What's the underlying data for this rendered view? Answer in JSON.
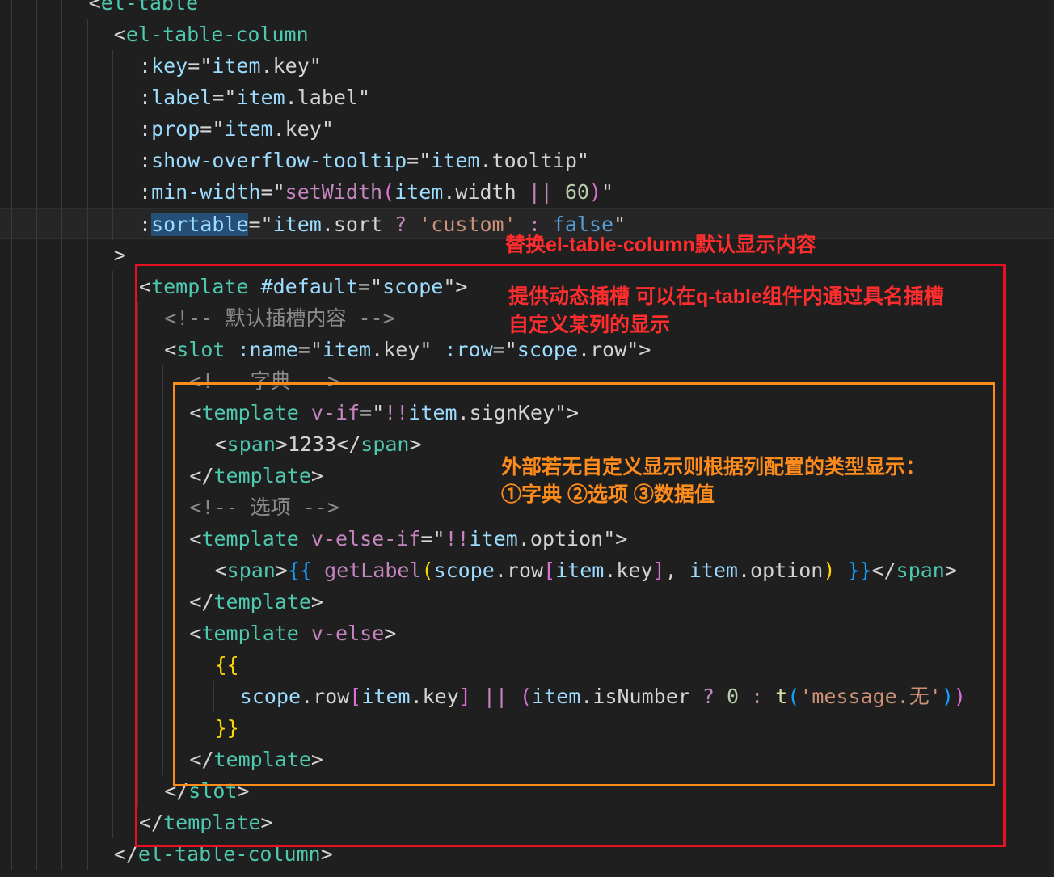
{
  "editor": {
    "lines": [
      {
        "indent": 3,
        "tokens": [
          {
            "c": "t-punc",
            "v": "<"
          },
          {
            "c": "t-tag",
            "v": "el-table"
          }
        ]
      },
      {
        "indent": 4,
        "tokens": [
          {
            "c": "t-punc",
            "v": "<"
          },
          {
            "c": "t-tag",
            "v": "el-table-column"
          }
        ]
      },
      {
        "indent": 5,
        "tokens": [
          {
            "c": "t-punc",
            "v": ":"
          },
          {
            "c": "t-attr",
            "v": "key"
          },
          {
            "c": "t-punc",
            "v": "=\""
          },
          {
            "c": "t-ident",
            "v": "item"
          },
          {
            "c": "t-punc",
            "v": "."
          },
          {
            "c": "t-prop",
            "v": "key"
          },
          {
            "c": "t-punc",
            "v": "\""
          }
        ]
      },
      {
        "indent": 5,
        "tokens": [
          {
            "c": "t-punc",
            "v": ":"
          },
          {
            "c": "t-attr",
            "v": "label"
          },
          {
            "c": "t-punc",
            "v": "=\""
          },
          {
            "c": "t-ident",
            "v": "item"
          },
          {
            "c": "t-punc",
            "v": "."
          },
          {
            "c": "t-prop",
            "v": "label"
          },
          {
            "c": "t-punc",
            "v": "\""
          }
        ]
      },
      {
        "indent": 5,
        "tokens": [
          {
            "c": "t-punc",
            "v": ":"
          },
          {
            "c": "t-attr",
            "v": "prop"
          },
          {
            "c": "t-punc",
            "v": "=\""
          },
          {
            "c": "t-ident",
            "v": "item"
          },
          {
            "c": "t-punc",
            "v": "."
          },
          {
            "c": "t-prop",
            "v": "key"
          },
          {
            "c": "t-punc",
            "v": "\""
          }
        ]
      },
      {
        "indent": 5,
        "tokens": [
          {
            "c": "t-punc",
            "v": ":"
          },
          {
            "c": "t-attr",
            "v": "show-overflow-tooltip"
          },
          {
            "c": "t-punc",
            "v": "=\""
          },
          {
            "c": "t-ident",
            "v": "item"
          },
          {
            "c": "t-punc",
            "v": "."
          },
          {
            "c": "t-prop",
            "v": "tooltip"
          },
          {
            "c": "t-punc",
            "v": "\""
          }
        ]
      },
      {
        "indent": 5,
        "tokens": [
          {
            "c": "t-punc",
            "v": ":"
          },
          {
            "c": "t-attr",
            "v": "min-width"
          },
          {
            "c": "t-punc",
            "v": "=\""
          },
          {
            "c": "t-fn2",
            "v": "setWidth"
          },
          {
            "c": "t-bracket2",
            "v": "("
          },
          {
            "c": "t-ident",
            "v": "item"
          },
          {
            "c": "t-punc",
            "v": "."
          },
          {
            "c": "t-prop",
            "v": "width "
          },
          {
            "c": "t-op",
            "v": "||"
          },
          {
            "c": "t-num",
            "v": " 60"
          },
          {
            "c": "t-bracket2",
            "v": ")"
          },
          {
            "c": "t-punc",
            "v": "\""
          }
        ]
      },
      {
        "indent": 5,
        "current": true,
        "tokens": [
          {
            "c": "t-punc",
            "v": ":"
          },
          {
            "c": "t-attr t-sel",
            "v": "sortable"
          },
          {
            "c": "t-punc",
            "v": "=\""
          },
          {
            "c": "t-ident",
            "v": "item"
          },
          {
            "c": "t-punc",
            "v": "."
          },
          {
            "c": "t-prop",
            "v": "sort "
          },
          {
            "c": "t-op",
            "v": "?"
          },
          {
            "c": "t-str",
            "v": " 'custom' "
          },
          {
            "c": "t-op",
            "v": ":"
          },
          {
            "c": "t-const",
            "v": " false"
          },
          {
            "c": "t-punc",
            "v": "\""
          }
        ]
      },
      {
        "indent": 4,
        "tokens": [
          {
            "c": "t-punc",
            "v": ">"
          }
        ]
      },
      {
        "indent": 5,
        "tokens": [
          {
            "c": "t-punc",
            "v": "<"
          },
          {
            "c": "t-tag",
            "v": "template"
          },
          {
            "c": "t-attr",
            "v": " #default"
          },
          {
            "c": "t-punc",
            "v": "=\""
          },
          {
            "c": "t-ident",
            "v": "scope"
          },
          {
            "c": "t-punc",
            "v": "\">"
          }
        ]
      },
      {
        "indent": 6,
        "tokens": [
          {
            "c": "t-comment",
            "v": "<!-- 默认插槽内容 -->"
          }
        ]
      },
      {
        "indent": 6,
        "tokens": [
          {
            "c": "t-punc",
            "v": "<"
          },
          {
            "c": "t-tag",
            "v": "slot"
          },
          {
            "c": "t-attr",
            "v": " :name"
          },
          {
            "c": "t-punc",
            "v": "=\""
          },
          {
            "c": "t-ident",
            "v": "item"
          },
          {
            "c": "t-punc",
            "v": "."
          },
          {
            "c": "t-prop",
            "v": "key"
          },
          {
            "c": "t-punc",
            "v": "\""
          },
          {
            "c": "t-attr",
            "v": " :row"
          },
          {
            "c": "t-punc",
            "v": "=\""
          },
          {
            "c": "t-ident",
            "v": "scope"
          },
          {
            "c": "t-punc",
            "v": "."
          },
          {
            "c": "t-prop",
            "v": "row"
          },
          {
            "c": "t-punc",
            "v": "\">"
          }
        ]
      },
      {
        "indent": 7,
        "tokens": [
          {
            "c": "t-comment",
            "v": "<!-- 字典 -->"
          }
        ]
      },
      {
        "indent": 7,
        "tokens": [
          {
            "c": "t-punc",
            "v": "<"
          },
          {
            "c": "t-tag",
            "v": "template"
          },
          {
            "c": "t-dir",
            "v": " v-if"
          },
          {
            "c": "t-punc",
            "v": "=\""
          },
          {
            "c": "t-op",
            "v": "!!"
          },
          {
            "c": "t-ident",
            "v": "item"
          },
          {
            "c": "t-punc",
            "v": "."
          },
          {
            "c": "t-prop",
            "v": "signKey"
          },
          {
            "c": "t-punc",
            "v": "\">"
          }
        ]
      },
      {
        "indent": 8,
        "tokens": [
          {
            "c": "t-punc",
            "v": "<"
          },
          {
            "c": "t-tag",
            "v": "span"
          },
          {
            "c": "t-punc",
            "v": ">"
          },
          {
            "c": "t-text",
            "v": "1233"
          },
          {
            "c": "t-punc",
            "v": "</"
          },
          {
            "c": "t-tag",
            "v": "span"
          },
          {
            "c": "t-punc",
            "v": ">"
          }
        ]
      },
      {
        "indent": 7,
        "tokens": [
          {
            "c": "t-punc",
            "v": "</"
          },
          {
            "c": "t-tag",
            "v": "template"
          },
          {
            "c": "t-punc",
            "v": ">"
          }
        ]
      },
      {
        "indent": 7,
        "tokens": [
          {
            "c": "t-comment",
            "v": "<!-- 选项 -->"
          }
        ]
      },
      {
        "indent": 7,
        "tokens": [
          {
            "c": "t-punc",
            "v": "<"
          },
          {
            "c": "t-tag",
            "v": "template"
          },
          {
            "c": "t-dir",
            "v": " v-else-if"
          },
          {
            "c": "t-punc",
            "v": "=\""
          },
          {
            "c": "t-op",
            "v": "!!"
          },
          {
            "c": "t-ident",
            "v": "item"
          },
          {
            "c": "t-punc",
            "v": "."
          },
          {
            "c": "t-prop",
            "v": "option"
          },
          {
            "c": "t-punc",
            "v": "\">"
          }
        ]
      },
      {
        "indent": 8,
        "tokens": [
          {
            "c": "t-punc",
            "v": "<"
          },
          {
            "c": "t-tag",
            "v": "span"
          },
          {
            "c": "t-punc",
            "v": ">"
          },
          {
            "c": "t-bracket3",
            "v": "{{"
          },
          {
            "c": "t-fn2",
            "v": " getLabel"
          },
          {
            "c": "t-bracket",
            "v": "("
          },
          {
            "c": "t-ident",
            "v": "scope"
          },
          {
            "c": "t-punc",
            "v": "."
          },
          {
            "c": "t-prop",
            "v": "row"
          },
          {
            "c": "t-bracket2",
            "v": "["
          },
          {
            "c": "t-ident",
            "v": "item"
          },
          {
            "c": "t-punc",
            "v": "."
          },
          {
            "c": "t-prop",
            "v": "key"
          },
          {
            "c": "t-bracket2",
            "v": "]"
          },
          {
            "c": "t-punc",
            "v": ", "
          },
          {
            "c": "t-ident",
            "v": "item"
          },
          {
            "c": "t-punc",
            "v": "."
          },
          {
            "c": "t-prop",
            "v": "option"
          },
          {
            "c": "t-bracket",
            "v": ")"
          },
          {
            "c": "t-bracket3",
            "v": " }}"
          },
          {
            "c": "t-punc",
            "v": "</"
          },
          {
            "c": "t-tag",
            "v": "span"
          },
          {
            "c": "t-punc",
            "v": ">"
          }
        ]
      },
      {
        "indent": 7,
        "tokens": [
          {
            "c": "t-punc",
            "v": "</"
          },
          {
            "c": "t-tag",
            "v": "template"
          },
          {
            "c": "t-punc",
            "v": ">"
          }
        ]
      },
      {
        "indent": 7,
        "tokens": [
          {
            "c": "t-punc",
            "v": "<"
          },
          {
            "c": "t-tag",
            "v": "template"
          },
          {
            "c": "t-dir",
            "v": " v-else"
          },
          {
            "c": "t-punc",
            "v": ">"
          }
        ]
      },
      {
        "indent": 8,
        "tokens": [
          {
            "c": "t-bracket",
            "v": "{{"
          }
        ]
      },
      {
        "indent": 9,
        "tokens": [
          {
            "c": "t-ident",
            "v": "scope"
          },
          {
            "c": "t-punc",
            "v": "."
          },
          {
            "c": "t-prop",
            "v": "row"
          },
          {
            "c": "t-bracket2",
            "v": "["
          },
          {
            "c": "t-ident",
            "v": "item"
          },
          {
            "c": "t-punc",
            "v": "."
          },
          {
            "c": "t-prop",
            "v": "key"
          },
          {
            "c": "t-bracket2",
            "v": "]"
          },
          {
            "c": "t-op",
            "v": " ||"
          },
          {
            "c": "t-bracket2",
            "v": " ("
          },
          {
            "c": "t-ident",
            "v": "item"
          },
          {
            "c": "t-punc",
            "v": "."
          },
          {
            "c": "t-prop",
            "v": "isNumber "
          },
          {
            "c": "t-op",
            "v": "?"
          },
          {
            "c": "t-num",
            "v": " 0 "
          },
          {
            "c": "t-op",
            "v": ":"
          },
          {
            "c": "t-fn",
            "v": " t"
          },
          {
            "c": "t-bracket3",
            "v": "("
          },
          {
            "c": "t-str",
            "v": "'message.无'"
          },
          {
            "c": "t-bracket3",
            "v": ")"
          },
          {
            "c": "t-bracket2",
            "v": ")"
          }
        ]
      },
      {
        "indent": 8,
        "tokens": [
          {
            "c": "t-bracket",
            "v": "}}"
          }
        ]
      },
      {
        "indent": 7,
        "tokens": [
          {
            "c": "t-punc",
            "v": "</"
          },
          {
            "c": "t-tag",
            "v": "template"
          },
          {
            "c": "t-punc",
            "v": ">"
          }
        ]
      },
      {
        "indent": 6,
        "tokens": [
          {
            "c": "t-punc",
            "v": "</"
          },
          {
            "c": "t-tag",
            "v": "slot"
          },
          {
            "c": "t-punc",
            "v": ">"
          }
        ]
      },
      {
        "indent": 5,
        "tokens": [
          {
            "c": "t-punc",
            "v": "</"
          },
          {
            "c": "t-tag",
            "v": "template"
          },
          {
            "c": "t-punc",
            "v": ">"
          }
        ]
      },
      {
        "indent": 4,
        "tokens": [
          {
            "c": "t-punc",
            "v": "</"
          },
          {
            "c": "t-tag",
            "v": "el-table-column"
          },
          {
            "c": "t-punc",
            "v": ">"
          }
        ]
      }
    ]
  },
  "annotations": {
    "note1": "替换el-table-column默认显示内容",
    "note2_line1": "提供动态插槽 可以在q-table组件内通过具名插槽",
    "note2_line2": "自定义某列的显示",
    "note3_line1": "外部若无自定义显示则根据列配置的类型显示：",
    "note3_line2": "①字典 ②选项 ③数据值"
  },
  "colors": {
    "background": "#1f1f1f",
    "box_red": "#e81123",
    "box_orange": "#ff8c1a"
  }
}
